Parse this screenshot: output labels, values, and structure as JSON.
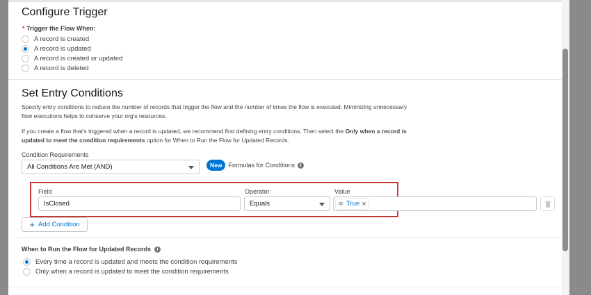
{
  "trigger": {
    "title": "Configure Trigger",
    "required_mark": "*",
    "label": "Trigger the Flow When:",
    "options": [
      "A record is created",
      "A record is updated",
      "A record is created or updated",
      "A record is deleted"
    ],
    "selected": 1
  },
  "entry": {
    "title": "Set Entry Conditions",
    "desc1": "Specify entry conditions to reduce the number of records that trigger the flow and the number of times the flow is executed. Minimizing unnecessary",
    "desc1b": "flow executions helps to conserve your org's resources.",
    "desc2a": "If you create a flow that's triggered when a record is updated, we recommend first defining entry conditions. Then select the ",
    "desc2b": "Only when a record is",
    "desc2c": "updated to meet the condition requirements",
    "desc2d": " option for When to Run the Flow for Updated Records.",
    "req_label": "Condition Requirements",
    "req_value": "All Conditions Are Met (AND)",
    "new_badge": "New",
    "formulas_label": "Formulas for Conditions",
    "info": "i",
    "field_label": "Field",
    "field_value": "IsClosed",
    "operator_label": "Operator",
    "operator_value": "Equals",
    "value_label": "Value",
    "value_pill": "True",
    "remove": "×",
    "add_condition": "Add Condition"
  },
  "run": {
    "title": "When to Run the Flow for Updated Records",
    "options": [
      "Every time a record is updated and meets the condition requirements",
      "Only when a record is updated to meet the condition requirements"
    ],
    "selected": 0
  },
  "colors": {
    "accent": "#0176d3",
    "highlight": "#c23934"
  }
}
